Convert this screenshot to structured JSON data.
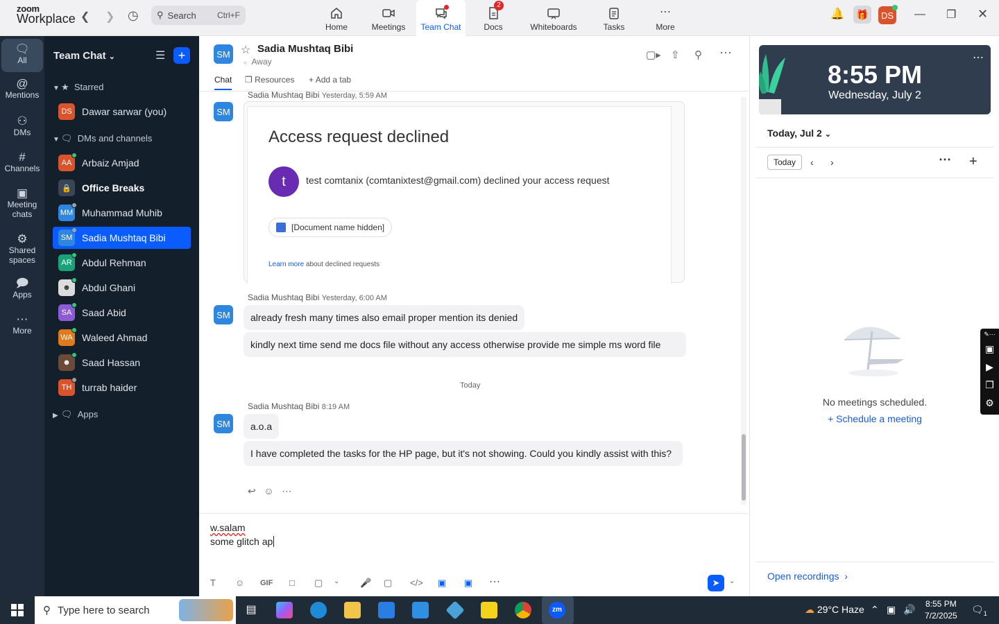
{
  "app": {
    "logo_line1": "zoom",
    "logo_line2": "Workplace"
  },
  "search": {
    "placeholder": "Search",
    "shortcut": "Ctrl+F"
  },
  "tabs": [
    {
      "label": "Home"
    },
    {
      "label": "Meetings"
    },
    {
      "label": "Team Chat"
    },
    {
      "label": "Docs",
      "badge": "2"
    },
    {
      "label": "Whiteboards"
    },
    {
      "label": "Tasks"
    },
    {
      "label": "More"
    }
  ],
  "user": {
    "initials": "DS"
  },
  "rail": [
    {
      "label": "All"
    },
    {
      "label": "Mentions"
    },
    {
      "label": "DMs"
    },
    {
      "label": "Channels"
    },
    {
      "label": "Meeting chats"
    },
    {
      "label": "Shared spaces"
    },
    {
      "label": "Apps"
    },
    {
      "label": "More"
    }
  ],
  "sidebar": {
    "title": "Team Chat",
    "starred_label": "Starred",
    "dms_label": "DMs and channels",
    "apps_label": "Apps",
    "starred": [
      {
        "initials": "DS",
        "name": "Dawar sarwar (you)",
        "color": "#d9532c"
      }
    ],
    "items": [
      {
        "initials": "AA",
        "name": "Arbaiz Amjad",
        "color": "#d9532c",
        "status": "#2ecc71"
      },
      {
        "initials": "",
        "name": "Office Breaks",
        "color": "#3a4656",
        "status": ""
      },
      {
        "initials": "MM",
        "name": "Muhammad Muhib",
        "color": "#2e86de",
        "status": "#9aa3ad"
      },
      {
        "initials": "SM",
        "name": "Sadia Mushtaq Bibi",
        "color": "#2e86de",
        "status": "#9aa3ad"
      },
      {
        "initials": "AR",
        "name": "Abdul Rehman",
        "color": "#1aa37a",
        "status": "#2ecc71"
      },
      {
        "initials": "",
        "name": "Abdul Ghani",
        "color": "#dcdcdc",
        "status": "#2ecc71"
      },
      {
        "initials": "SA",
        "name": "Saad Abid",
        "color": "#8e5bd6",
        "status": "#2ecc71"
      },
      {
        "initials": "WA",
        "name": "Waleed Ahmad",
        "color": "#e07a1f",
        "status": "#2ecc71"
      },
      {
        "initials": "",
        "name": "Saad Hassan",
        "color": "#6b4a3a",
        "status": "#2ecc71"
      },
      {
        "initials": "TH",
        "name": "turrab haider",
        "color": "#d9532c",
        "status": "#9aa3ad"
      }
    ]
  },
  "chat": {
    "initials": "SM",
    "name": "Sadia Mushtaq Bibi",
    "status": "Away",
    "tabs": [
      "Chat",
      "Resources",
      "Add a tab"
    ],
    "messages": {
      "m1_sender": "Sadia Mushtaq Bibi",
      "m1_time": "Yesterday, 5:59 AM",
      "card_title": "Access request declined",
      "card_avatar": "t",
      "card_text": "test comtanix (comtanixtest@gmail.com) declined your access request",
      "card_doc": "[Document name hidden]",
      "card_learn_link": "Learn more",
      "card_learn_rest": " about declined requests",
      "m2_sender": "Sadia Mushtaq Bibi",
      "m2_time": "Yesterday, 6:00 AM",
      "m2_text1": "already fresh many times also email proper mention its denied",
      "m2_text2": "kindly next time send me docs file without any access otherwise provide me simple ms word file",
      "divider": "Today",
      "m3_sender": "Sadia Mushtaq Bibi",
      "m3_time": "8:19 AM",
      "m3_text1": "a.o.a",
      "m3_text2": "I have completed the tasks for the HP page, but it's not showing. Could you kindly assist with this?"
    },
    "composer": {
      "line1": "w.salam",
      "line2": "some glitch ap"
    }
  },
  "rightpanel": {
    "time": "8:55 PM",
    "date": "Wednesday, July 2",
    "day_header": "Today, Jul 2",
    "today_btn": "Today",
    "empty": "No meetings scheduled.",
    "schedule": "Schedule a meeting",
    "recordings": "Open recordings"
  },
  "taskbar": {
    "search": "Type here to search",
    "weather": "29°C  Haze",
    "time": "8:55 PM",
    "date": "7/2/2025",
    "notif": "1"
  },
  "colors": {
    "accent": "#0b5cff",
    "sidebar": "#141f2c",
    "rail": "#1f2b3a"
  }
}
